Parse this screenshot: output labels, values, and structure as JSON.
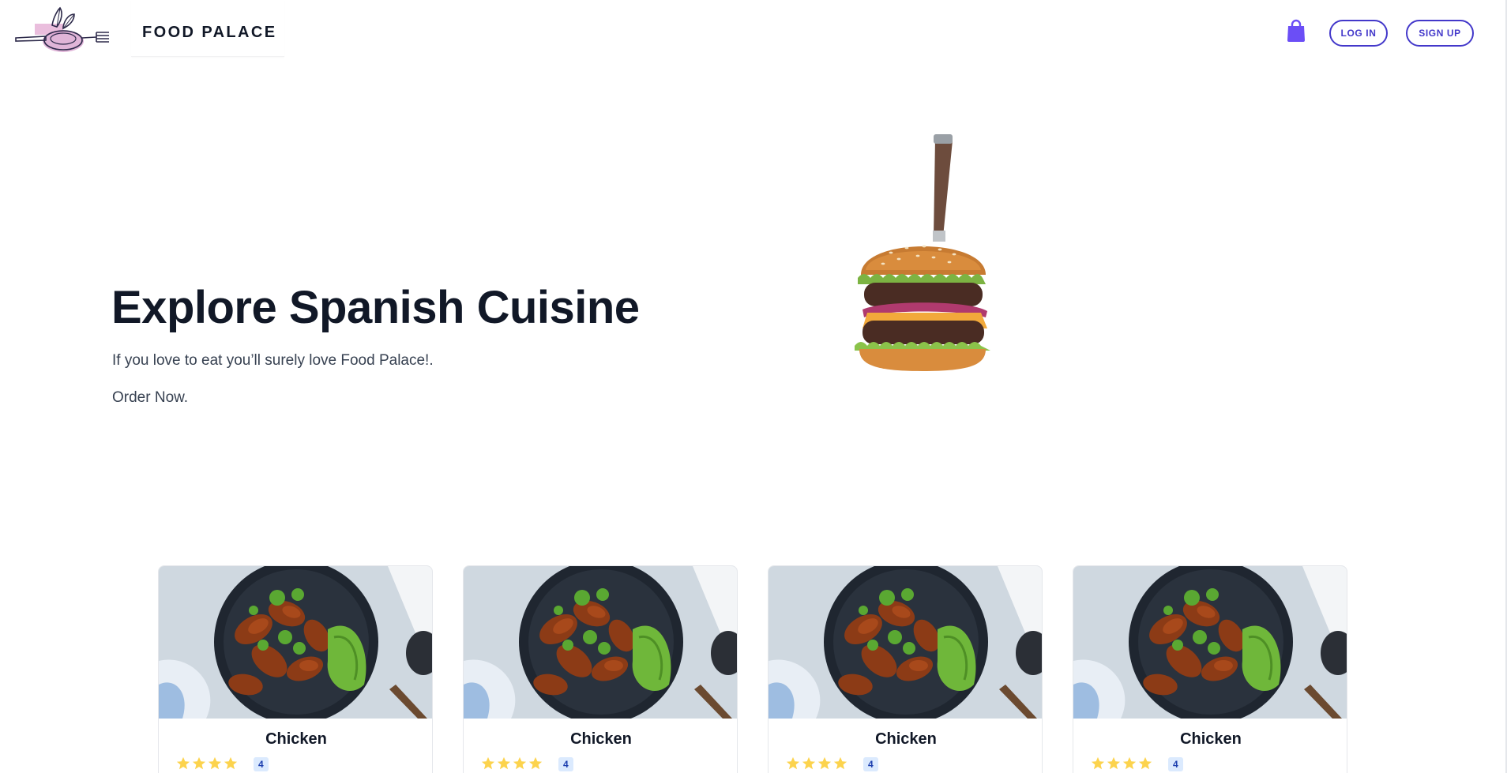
{
  "header": {
    "brand": "FOOD PALACE",
    "login_label": "LOG IN",
    "signup_label": "SIGN UP",
    "accent_color": "#4338ca",
    "cart_icon": "shopping-bag-icon"
  },
  "hero": {
    "title": "Explore Spanish Cuisine",
    "subtitle": "If you love to eat you’ll surely love Food Palace!.",
    "cta": "Order Now."
  },
  "cards": [
    {
      "title": "Chicken",
      "stars": 4,
      "rating": "4"
    },
    {
      "title": "Chicken",
      "stars": 4,
      "rating": "4"
    },
    {
      "title": "Chicken",
      "stars": 4,
      "rating": "4"
    },
    {
      "title": "Chicken",
      "stars": 4,
      "rating": "4"
    }
  ]
}
